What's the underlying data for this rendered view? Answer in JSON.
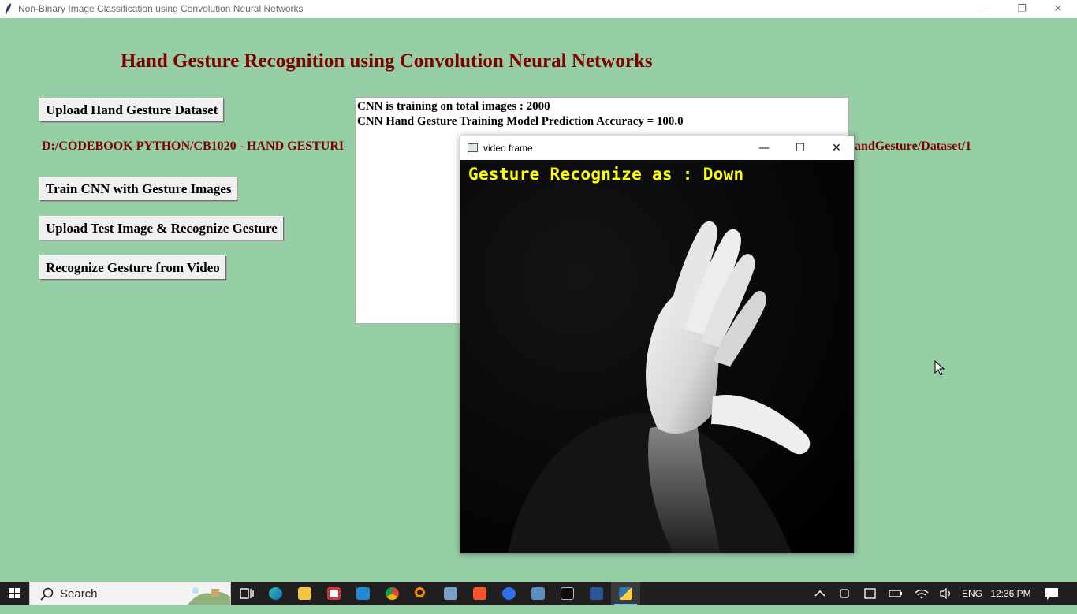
{
  "window": {
    "title": "Non-Binary Image Classification using Convolution Neural Networks",
    "minimize": "—",
    "restore": "❐",
    "close": "✕"
  },
  "heading": "Hand Gesture Recognition using Convolution Neural Networks",
  "buttons": {
    "upload_dataset": "Upload Hand Gesture Dataset",
    "train_cnn": "Train CNN with Gesture Images",
    "upload_test": "Upload Test Image & Recognize Gesture",
    "recognize_video": "Recognize Gesture from Video"
  },
  "dataset_path": {
    "visible_start": "D:/CODEBOOK PYTHON/CB1020 - HAND GESTURI",
    "visible_end": "andGesture/Dataset/1"
  },
  "output_text": [
    "CNN is training on total images : 2000",
    "CNN Hand Gesture Training Model Prediction Accuracy = 100.0"
  ],
  "video_window": {
    "title": "video frame",
    "minimize": "—",
    "maximize": "☐",
    "close": "✕",
    "overlay_text": "Gesture Recognize as : Down"
  },
  "taskbar": {
    "search_placeholder": "Search",
    "language": "ENG",
    "time": "12:36 PM",
    "apps": [
      "task-view",
      "edge",
      "file-explorer",
      "app-red",
      "vscode",
      "chrome",
      "search-app",
      "app-photos",
      "brave",
      "app-blue",
      "app-monitor",
      "terminal",
      "word",
      "python"
    ]
  },
  "colors": {
    "background": "#96cea6",
    "heading": "#800000",
    "overlay": "#ffff00",
    "taskbar": "#1f1f1f"
  }
}
